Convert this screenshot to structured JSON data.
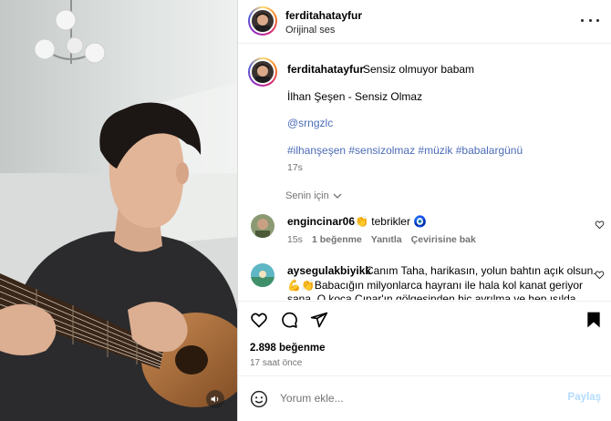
{
  "header": {
    "username": "ferditahatayfur",
    "audio": "Orijinal ses"
  },
  "caption": {
    "username": "ferditahatayfur",
    "text": "Sensiz olmuyor babam",
    "song": "İlhan Şeşen - Sensiz Olmaz",
    "mention": "@srngzlc",
    "hashtags": "#ilhanşeşen #sensizolmaz #müzik #babalargünü",
    "time": "17s"
  },
  "filter": {
    "label": "Senin için"
  },
  "comments": [
    {
      "username": "engincinar06",
      "text": "👏 tebrikler 🧿",
      "time": "15s",
      "likes": "1 beğenme",
      "reply": "Yanıtla",
      "translate": "Çevirisine bak"
    },
    {
      "username": "aysegulakbiyikk",
      "line1": "Canım Taha, harikasın, yolun bahtın açık olsun.",
      "line2": "💪👏Babacığın milyonlarca hayranı ile hala kol kanat geriyor",
      "line3": "sana. O koca Çınar'ın gölgesinden hiç ayrılma ve hep ışıldа"
    }
  ],
  "stats": {
    "likes": "2.898 beğenme",
    "time": "17 saat önce"
  },
  "composer": {
    "placeholder": "Yorum ekle...",
    "post_label": "Paylaş"
  },
  "colors": {
    "link": "#4b6cb7",
    "post_disabled": "#b3dbff",
    "secondary_text": "#737373"
  }
}
